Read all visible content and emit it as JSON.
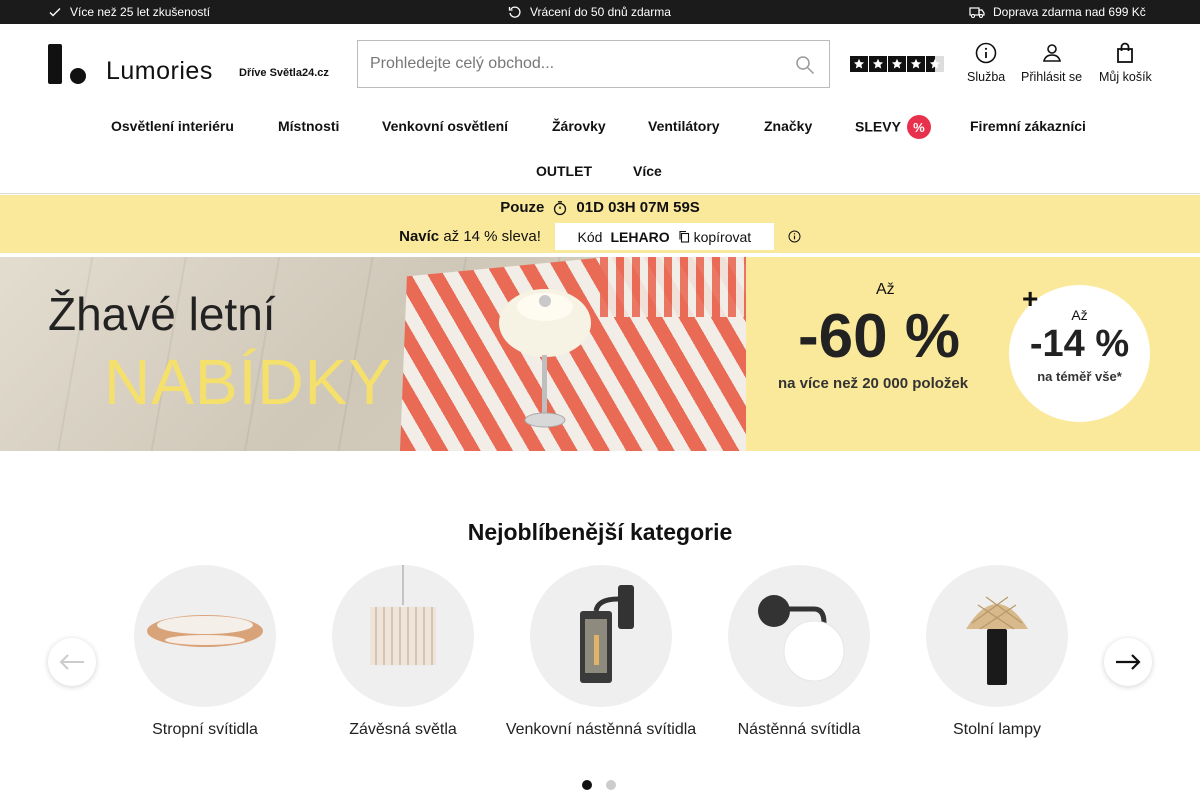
{
  "topbar": {
    "item1": "Více než 25 let zkušeností",
    "item2": "Vrácení do 50 dnů zdarma",
    "item3": "Doprava zdarma nad 699 Kč"
  },
  "header": {
    "logo_text": "Lumories",
    "logo_sub": "Dříve Světla24.cz",
    "search_placeholder": "Prohledejte celý obchod...",
    "rating_stars": 4.5,
    "service_label": "Služba",
    "login_label": "Přihlásit se",
    "cart_label": "Můj košík"
  },
  "nav": {
    "items": [
      "Osvětlení interiéru",
      "Místnosti",
      "Venkovní osvětlení",
      "Žárovky",
      "Ventilátory",
      "Značky",
      "SLEVY",
      "Firemní zákazníci",
      "OUTLET",
      "Více"
    ],
    "sale_badge": "%"
  },
  "promo": {
    "only": "Pouze",
    "countdown": "01D 03H 07M 59S",
    "extra_bold": "Navíc",
    "extra_text": "až 14 % sleva!",
    "code_label": "Kód",
    "code_value": "LEHARO",
    "copy_label": "kopírovat"
  },
  "banner": {
    "title_line1": "Žhavé letní",
    "title_line2": "NABÍDKY",
    "up_to_1": "Až",
    "discount_main": "-60 %",
    "discount_main_sub": "na více než 20 000 položek",
    "plus": "+",
    "up_to_2": "Až",
    "discount_extra": "-14 %",
    "discount_extra_sub": "na téměř vše*"
  },
  "categories": {
    "title": "Nejoblíbenější kategorie",
    "items": [
      "Stropní svítidla",
      "Závěsná světla",
      "Venkovní nástěnná svítidla",
      "Nástěnná svítidla",
      "Stolní lampy"
    ],
    "active_page": 1,
    "pages": 2
  },
  "colors": {
    "topbar_bg": "#1b1b1b",
    "promo_bg": "#fbe99b",
    "sale_red": "#e8324d",
    "banner_accent": "#f4e06b"
  }
}
